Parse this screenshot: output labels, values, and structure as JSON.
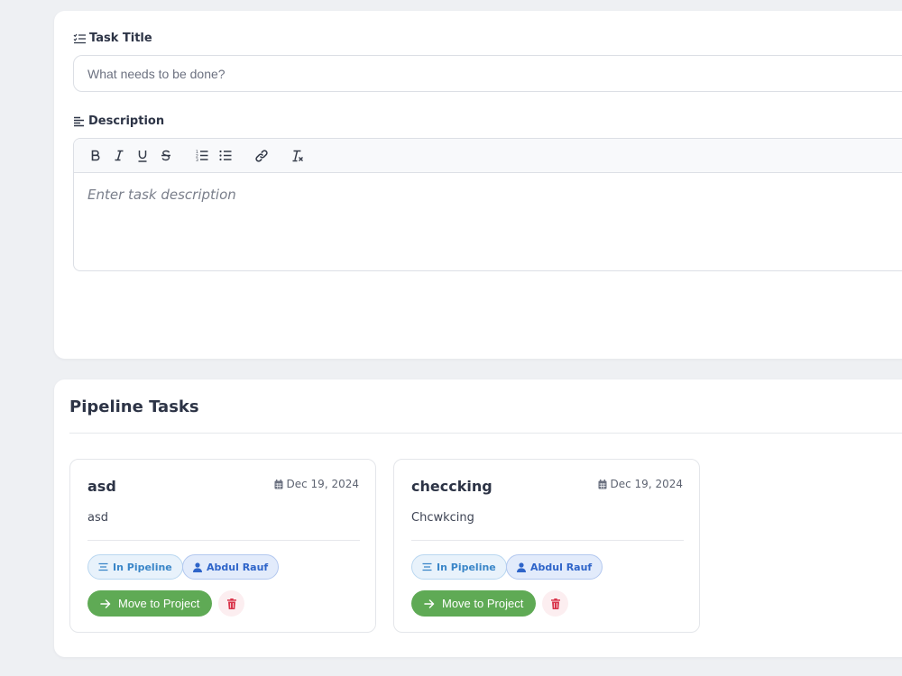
{
  "form": {
    "title_label": "Task Title",
    "title_placeholder": "What needs to be done?",
    "description_label": "Description",
    "description_placeholder": "Enter task description",
    "toolbar": [
      "bold",
      "italic",
      "underline",
      "strikethrough",
      "ordered-list",
      "bullet-list",
      "link",
      "clear-format"
    ]
  },
  "pipeline": {
    "title": "Pipeline Tasks",
    "tasks": [
      {
        "title": "asd",
        "date": "Dec 19, 2024",
        "description": "asd",
        "status": "In Pipeline",
        "assignee": "Abdul Rauf",
        "move_label": "Move to Project"
      },
      {
        "title": "checcking",
        "date": "Dec 19, 2024",
        "description": "Chcwkcing",
        "status": "In Pipeline",
        "assignee": "Abdul Rauf",
        "move_label": "Move to Project"
      }
    ]
  },
  "colors": {
    "move_button": "#5faa55",
    "status_badge": "#3a86c8",
    "user_badge": "#2e64c9",
    "delete_icon": "#d9344a"
  }
}
